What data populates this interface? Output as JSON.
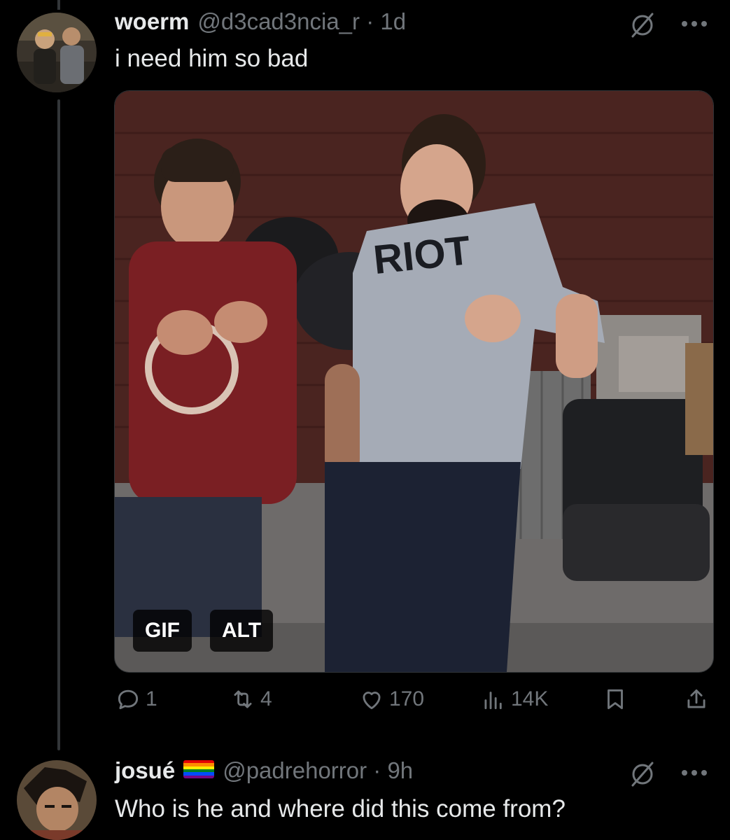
{
  "post": {
    "display_name": "woerm",
    "handle": "@d3cad3ncia_r · 1d",
    "text": "i need him so bad",
    "avatar_icon": "avatar-two-people-photo-icon",
    "media": {
      "shirt_text": "RIOT",
      "badges": {
        "gif": "GIF",
        "alt": "ALT"
      }
    },
    "actions": {
      "replies": "1",
      "reposts": "4",
      "likes": "170",
      "views": "14K"
    }
  },
  "reply": {
    "display_name": "josué",
    "flag_icon": "rainbow-flag-icon",
    "handle": "@padrehorror · 9h",
    "text": "Who is he and where did this come from?",
    "avatar_icon": "avatar-anime-character-icon"
  },
  "colors": {
    "background": "#000000",
    "text_primary": "#e7e9ea",
    "text_secondary": "#71767b",
    "thread_line": "#333639"
  }
}
